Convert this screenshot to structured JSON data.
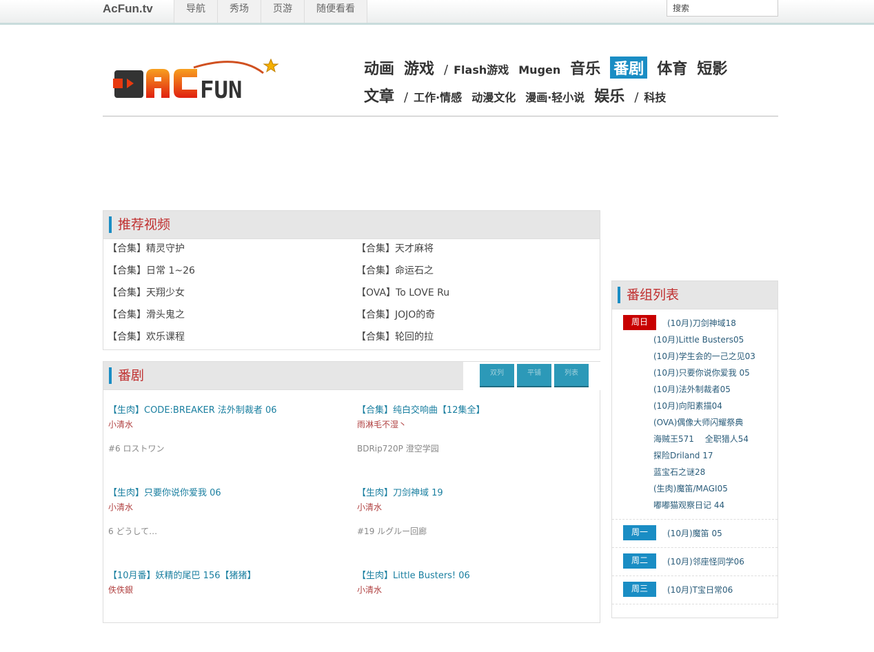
{
  "topbar": {
    "brand": "AcFun.tv",
    "nav": [
      "导航",
      "秀场",
      "页游",
      "随便看看"
    ],
    "search_placeholder": "搜索"
  },
  "logo": {
    "text": "ACFUN"
  },
  "mainnav": {
    "row1": [
      {
        "t": "动画",
        "c": "big"
      },
      {
        "t": "游戏",
        "c": "big"
      },
      {
        "t": "/",
        "c": "slash"
      },
      {
        "t": "Flash游戏",
        "c": "sm"
      },
      {
        "t": "Mugen",
        "c": "sm"
      },
      {
        "t": "音乐",
        "c": "big"
      },
      {
        "t": "番剧",
        "c": "big active"
      },
      {
        "t": "体育",
        "c": "big"
      },
      {
        "t": "短影",
        "c": "big"
      }
    ],
    "row2": [
      {
        "t": "文章",
        "c": "big"
      },
      {
        "t": "/",
        "c": "slash"
      },
      {
        "t": "工作·情感",
        "c": "sm"
      },
      {
        "t": "动漫文化",
        "c": "sm"
      },
      {
        "t": "漫画·轻小说",
        "c": "sm"
      },
      {
        "t": "娱乐",
        "c": "big"
      },
      {
        "t": "/",
        "c": "slash"
      },
      {
        "t": "科技",
        "c": "sm"
      }
    ]
  },
  "recommended": {
    "title": "推荐视频",
    "items": [
      "【合集】精灵守护",
      "【合集】天才麻将",
      "【合集】日常 1~26",
      "【合集】命运石之",
      "【合集】天翔少女",
      "【OVA】To LOVE Ru",
      "【合集】滑头鬼之",
      "【合集】JOJO的奇",
      "【合集】欢乐课程",
      "【合集】轮回的拉"
    ]
  },
  "bangumi": {
    "title": "番剧",
    "view_buttons": [
      "双列",
      "平铺",
      "列表"
    ],
    "videos": [
      {
        "title": "【生肉】CODE:BREAKER 法外制裁者 06",
        "author": "小清水",
        "desc": "#6 ロストワン"
      },
      {
        "title": "【合集】纯白交响曲【12集全】",
        "author": "雨淋毛不湿丶",
        "desc": "BDRip720P 澄空学园"
      },
      {
        "title": "【生肉】只要你说你爱我 06",
        "author": "小清水",
        "desc": "6 どうして…"
      },
      {
        "title": "【生肉】刀剑神域 19",
        "author": "小清水",
        "desc": "#19 ルグルー回廊"
      },
      {
        "title": "【10月番】妖精的尾巴 156【猪猪】",
        "author": "佚佚銀",
        "desc": ""
      },
      {
        "title": "【生肉】Little Busters! 06",
        "author": "小清水",
        "desc": ""
      }
    ]
  },
  "schedule": {
    "title": "番组列表",
    "days": [
      {
        "day": "周日",
        "active": true,
        "items": [
          "(10月)刀剑神域18",
          "(10月)Little Busters05",
          "(10月)学生会的一己之见03",
          "(10月)只要你说你爱我 05",
          "(10月)法外制裁者05",
          "(10月)向阳素描04",
          "(OVA)偶像大师闪耀祭典",
          "海贼王571　 全职猎人54",
          "探险Driland 17",
          "蓝宝石之谜28",
          "(生肉)魔笛/MAGI05",
          "嘟嘟猫观察日记 44"
        ]
      },
      {
        "day": "周一",
        "items": [
          "(10月)魔笛 05"
        ]
      },
      {
        "day": "周二",
        "items": [
          "(10月)邻座怪同学06"
        ]
      },
      {
        "day": "周三",
        "items": [
          "(10月)T宝日常06"
        ]
      }
    ]
  }
}
